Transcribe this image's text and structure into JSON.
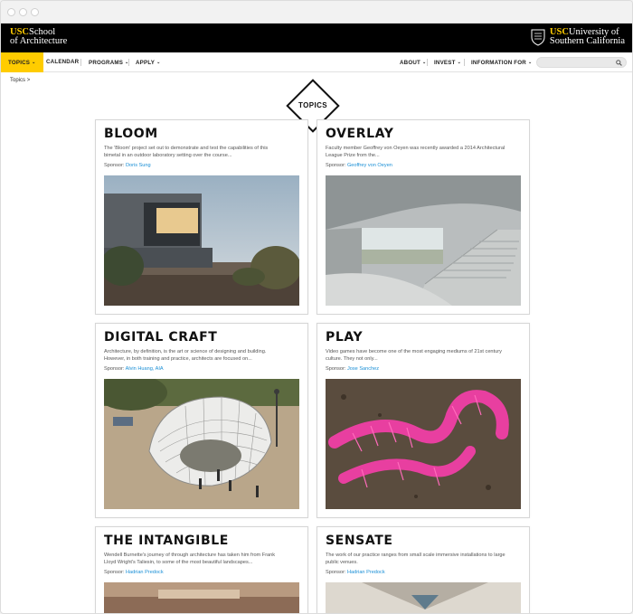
{
  "header": {
    "school_logo": {
      "usc": "USC",
      "line1": "School",
      "line2": "of Architecture"
    },
    "university_logo": {
      "usc": "USC",
      "line1": "University of",
      "line2": "Southern California"
    }
  },
  "nav": {
    "left": [
      {
        "label": "TOPICS",
        "has_caret": true,
        "active": true
      },
      {
        "label": "CALENDAR",
        "has_caret": false
      },
      {
        "label": "PROGRAMS",
        "has_caret": true
      },
      {
        "label": "APPLY",
        "has_caret": true
      }
    ],
    "right": [
      {
        "label": "ABOUT",
        "has_caret": true
      },
      {
        "label": "INVEST",
        "has_caret": true
      },
      {
        "label": "INFORMATION FOR",
        "has_caret": true
      }
    ],
    "caret_glyph": "⌄",
    "search": {
      "icon": "search-icon",
      "placeholder": ""
    }
  },
  "breadcrumb": {
    "label": "Topics",
    "separator": ">"
  },
  "badge": {
    "label": "TOPICS"
  },
  "cards": [
    {
      "title": "BLOOM",
      "desc": "The 'Bloom' project set out to demonstrate and test the capabilities of this bimetal in an outdoor laboratory setting over the course...",
      "sponsor_label": "Sponsor:",
      "sponsor": "Doris Sung",
      "image": "concrete-house-desert"
    },
    {
      "title": "OVERLAY",
      "desc": "Faculty member Geoffrey von Oeyen was recently awarded a 2014 Architectural League Prize from the...",
      "sponsor_label": "Sponsor:",
      "sponsor": "Geoffrey von Oeyen",
      "image": "concrete-stair-rendering"
    },
    {
      "title": "DIGITAL CRAFT",
      "desc": "Architecture, by definition, is the art or science of designing and building. However, in both training and practice, architects are focused on...",
      "sponsor_label": "Sponsor:",
      "sponsor": "Alvin Huang, AIA",
      "image": "pavilion-lattice"
    },
    {
      "title": "PLAY",
      "desc": "Video games have become one of the most engaging mediums of 21st century culture. They not only...",
      "sponsor_label": "Sponsor:",
      "sponsor": "Jose Sanchez",
      "image": "pink-structure"
    },
    {
      "title": "THE INTANGIBLE",
      "desc": "Wendell Burnette's journey of through architecture has taken him from Frank Lloyd Wright's Taliesin, to some of the most beautiful landscapes...",
      "sponsor_label": "Sponsor:",
      "sponsor": "Hadrian Predock",
      "image": "interior-warm"
    },
    {
      "title": "SENSATE",
      "desc": "The work of our practice ranges from small scale immersive installations to large public venues.",
      "sponsor_label": "Sponsor:",
      "sponsor": "Hadrian Predock",
      "image": "interior-light"
    }
  ],
  "colors": {
    "accent": "#ffcc00",
    "link": "#1a8fd6",
    "brandbar": "#000000",
    "pink": "#e83fa0"
  }
}
